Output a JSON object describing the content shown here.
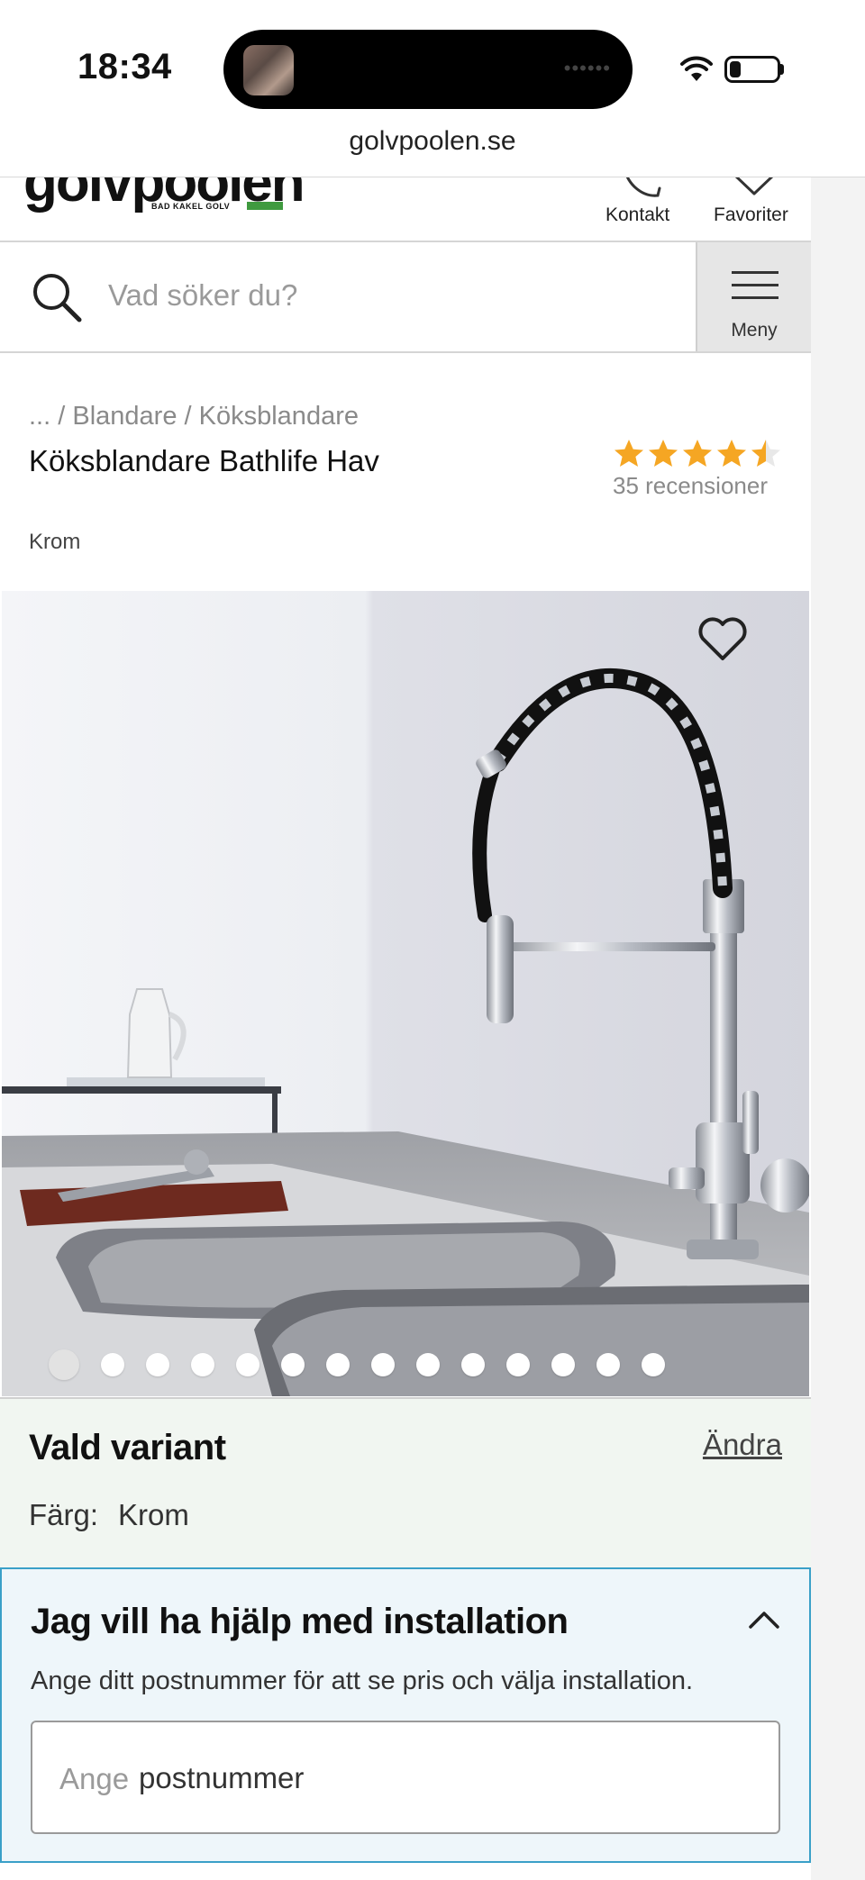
{
  "status_bar": {
    "time": "18:34"
  },
  "browser": {
    "url": "golvpoolen.se"
  },
  "header": {
    "logo_text": "golvpoolen",
    "logo_tagline": "BAD KAKEL GOLV",
    "contact_label": "Kontakt",
    "favorites_label": "Favoriter",
    "search_placeholder": "Vad söker du?",
    "menu_label": "Meny"
  },
  "breadcrumb": [
    "...",
    "Blandare",
    "Köksblandare"
  ],
  "product": {
    "title": "Köksblandare Bathlife Hav",
    "color": "Krom",
    "rating": 4.5,
    "rating_max": 5,
    "review_count_text": "35 recensioner",
    "star_color": "#f5a623"
  },
  "gallery": {
    "image_count": 14,
    "current_index": 1
  },
  "variant": {
    "title": "Vald variant",
    "change_label": "Ändra",
    "attribute_label": "Färg:",
    "attribute_value": "Krom"
  },
  "installation": {
    "title": "Jag vill ha hjälp med installation",
    "description": "Ange ditt postnummer för att se pris och välja installation.",
    "input_hint": "Ange",
    "input_placeholder": "postnummer",
    "accent_color": "#3aa0c8"
  }
}
